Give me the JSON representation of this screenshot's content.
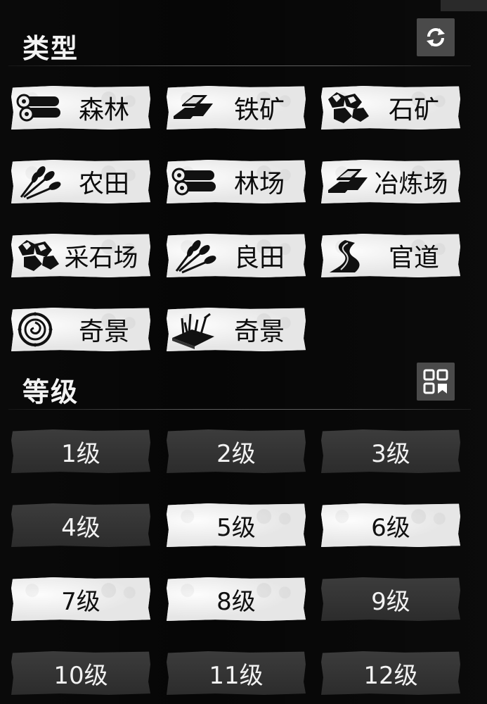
{
  "type_section": {
    "title": "类型"
  },
  "level_section": {
    "title": "等级"
  },
  "type_tiles": [
    {
      "label": "森林",
      "icon": "logs-icon"
    },
    {
      "label": "铁矿",
      "icon": "ingots-icon"
    },
    {
      "label": "石矿",
      "icon": "stones-icon"
    },
    {
      "label": "农田",
      "icon": "wheat-icon"
    },
    {
      "label": "林场",
      "icon": "logs-icon"
    },
    {
      "label": "冶炼场",
      "icon": "ingots-icon"
    },
    {
      "label": "采石场",
      "icon": "stones-icon"
    },
    {
      "label": "良田",
      "icon": "wheat-icon"
    },
    {
      "label": "官道",
      "icon": "road-icon"
    },
    {
      "label": "奇景",
      "icon": "swirl-emblem-icon"
    },
    {
      "label": "奇景",
      "icon": "grass-plot-icon"
    }
  ],
  "level_tiles": [
    {
      "label": "1级",
      "selected": false
    },
    {
      "label": "2级",
      "selected": false
    },
    {
      "label": "3级",
      "selected": false
    },
    {
      "label": "4级",
      "selected": false
    },
    {
      "label": "5级",
      "selected": true
    },
    {
      "label": "6级",
      "selected": true
    },
    {
      "label": "7级",
      "selected": true
    },
    {
      "label": "8级",
      "selected": true
    },
    {
      "label": "9级",
      "selected": false
    },
    {
      "label": "10级",
      "selected": false
    },
    {
      "label": "11级",
      "selected": false
    },
    {
      "label": "12级",
      "selected": false
    }
  ],
  "buttons": {
    "refresh_icon": "refresh-icon",
    "grid_icon": "grid-view-icon"
  }
}
